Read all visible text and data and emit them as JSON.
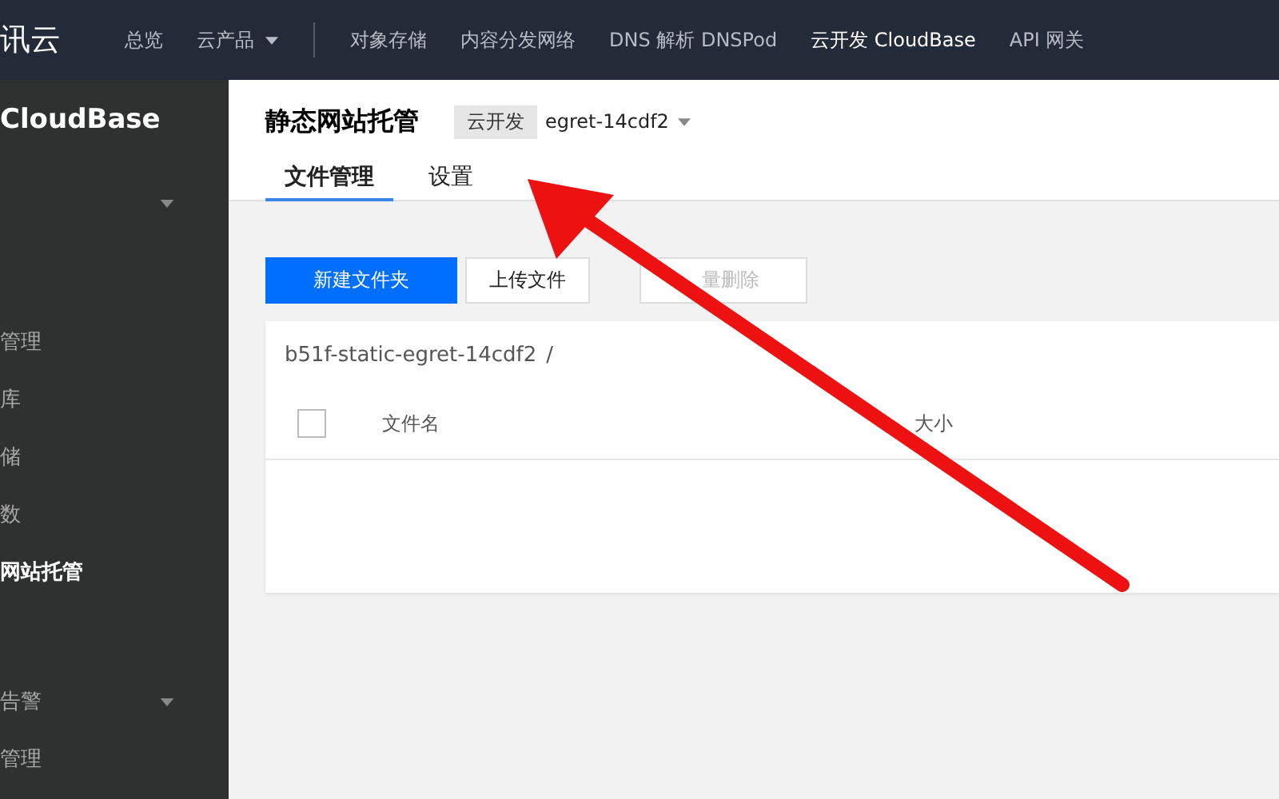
{
  "topbar": {
    "logo": "讯云",
    "nav": [
      {
        "label": "总览",
        "selected": false,
        "dropdown": false
      },
      {
        "label": "云产品",
        "selected": false,
        "dropdown": true
      },
      {
        "label": "对象存储",
        "selected": false,
        "dropdown": false
      },
      {
        "label": "内容分发网络",
        "selected": false,
        "dropdown": false
      },
      {
        "label": "DNS 解析 DNSPod",
        "selected": false,
        "dropdown": false
      },
      {
        "label": "云开发 CloudBase",
        "selected": true,
        "dropdown": false
      },
      {
        "label": "API 网关",
        "selected": false,
        "dropdown": false
      }
    ]
  },
  "sidebar": {
    "title": "CloudBase",
    "items": [
      {
        "label": "管理",
        "selected": false,
        "dropdown": false
      },
      {
        "label": "库",
        "selected": false,
        "dropdown": false
      },
      {
        "label": "储",
        "selected": false,
        "dropdown": false
      },
      {
        "label": "数",
        "selected": false,
        "dropdown": false
      },
      {
        "label": "网站托管",
        "selected": true,
        "dropdown": false
      },
      {
        "label": "告警",
        "selected": false,
        "dropdown": true
      },
      {
        "label": "管理",
        "selected": false,
        "dropdown": false
      }
    ]
  },
  "header": {
    "title": "静态网站托管",
    "tag": "云开发",
    "env": "egret-14cdf2"
  },
  "tabs": [
    {
      "label": "文件管理",
      "selected": true
    },
    {
      "label": "设置",
      "selected": false
    }
  ],
  "toolbar": [
    {
      "label": "新建文件夹",
      "kind": "primary",
      "disabled": false
    },
    {
      "label": "上传文件",
      "kind": "default",
      "disabled": false
    },
    {
      "label": "量删除",
      "kind": "default",
      "disabled": true
    }
  ],
  "panel": {
    "path": "b51f-static-egret-14cdf2",
    "separator": "/",
    "select_all": {
      "checked": false
    },
    "columns": [
      "文件名",
      "大小"
    ]
  }
}
